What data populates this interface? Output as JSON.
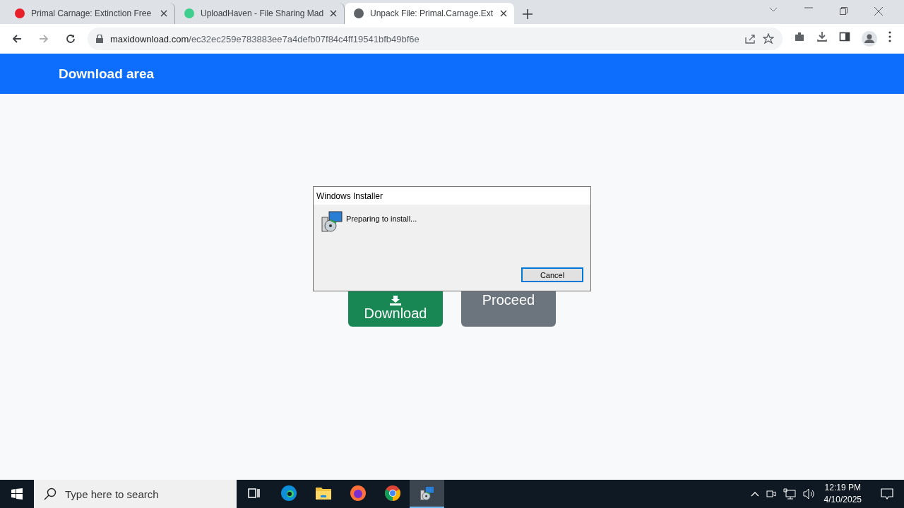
{
  "browser": {
    "tabs": [
      {
        "title": "Primal Carnage: Extinction Free",
        "selected": false
      },
      {
        "title": "UploadHaven - File Sharing Mad",
        "selected": false
      },
      {
        "title": "Unpack File: Primal.Carnage.Ext",
        "selected": true
      }
    ],
    "address": {
      "domain": "maxidownload.com",
      "path": "/ec32ec259e783883ee7a4defb07f84c4ff19541bfb49bf6e"
    }
  },
  "page": {
    "header": "Download area",
    "buttons": [
      {
        "label": "Download",
        "kind": "download"
      },
      {
        "label": "Proceed",
        "kind": "proceed"
      }
    ]
  },
  "dialog": {
    "title": "Windows Installer",
    "message": "Preparing to install...",
    "button": "Cancel"
  },
  "taskbar": {
    "search_placeholder": "Type here to search",
    "apps": [
      {
        "kind": "taskview",
        "selected": false
      },
      {
        "kind": "edge",
        "selected": false
      },
      {
        "kind": "explorer",
        "selected": false
      },
      {
        "kind": "firefox",
        "selected": false
      },
      {
        "kind": "chrome",
        "selected": false
      },
      {
        "kind": "installer",
        "selected": true
      }
    ],
    "time": "12:19 PM",
    "date": "4/10/2025"
  }
}
